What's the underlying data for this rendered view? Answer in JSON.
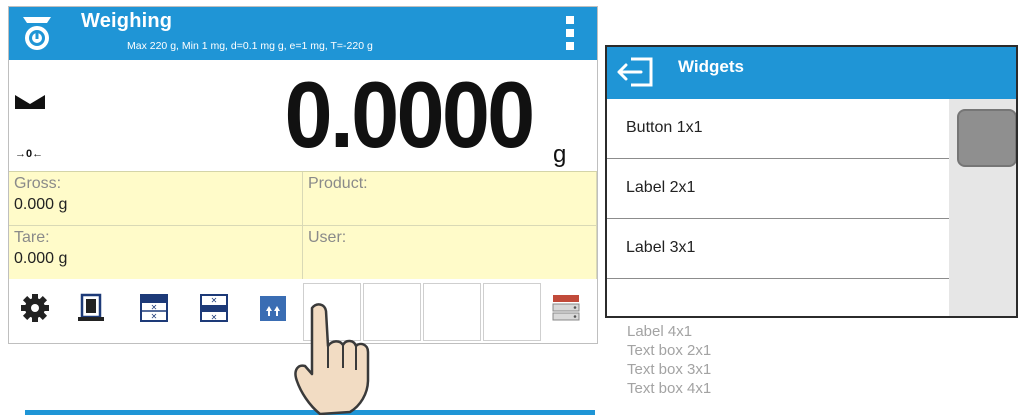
{
  "weighing_screen": {
    "title": "Weighing",
    "metrology": "Max 220 g, Min 1 mg, d=0.1 mg g, e=1 mg, T=-220 g",
    "weight": "0.0000",
    "unit": "g",
    "zero_indicator": "→0←",
    "info": {
      "gross_label": "Gross:",
      "gross_value": "0.000 g",
      "product_label": "Product:",
      "tare_label": "Tare:",
      "tare_value": "0.000 g",
      "user_label": "User:"
    },
    "toolbar_icons": [
      "gear-icon",
      "tare-weight-icon",
      "x-grid-icon",
      "x-grid-icon",
      "up-arrows-icon",
      "database-icon"
    ],
    "colors": {
      "header": "#1f95d6",
      "info_bg": "#fffbc9"
    }
  },
  "widgets_panel": {
    "title": "Widgets",
    "items": [
      "Button 1x1",
      "Label 2x1",
      "Label 3x1"
    ],
    "overflow_items": [
      "Label 4x1",
      "Text box 2x1",
      "Text box 3x1",
      "Text box 4x1"
    ]
  }
}
